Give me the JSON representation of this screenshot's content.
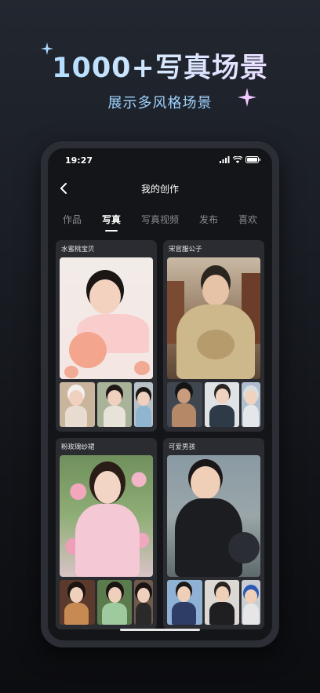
{
  "hero": {
    "title": "1000+写真场景",
    "subtitle": "展示多风格场景"
  },
  "status_bar": {
    "time": "19:27"
  },
  "nav": {
    "title": "我的创作"
  },
  "tabs": [
    {
      "label": "作品",
      "active": false
    },
    {
      "label": "写真",
      "active": true
    },
    {
      "label": "写真视频",
      "active": false
    },
    {
      "label": "发布",
      "active": false
    },
    {
      "label": "喜欢",
      "active": false
    }
  ],
  "cards": [
    {
      "title": "水蜜桃宝贝"
    },
    {
      "title": "宋官服公子"
    },
    {
      "title": "粉玫瑰纱裙"
    },
    {
      "title": "可爱男孩"
    }
  ],
  "colors": {
    "background": "#14151a",
    "card": "#2a2c31",
    "hero_gradient_start": "#9fd6ff",
    "hero_gradient_end": "#f3d8ff",
    "subtitle": "#9fd3ff"
  }
}
